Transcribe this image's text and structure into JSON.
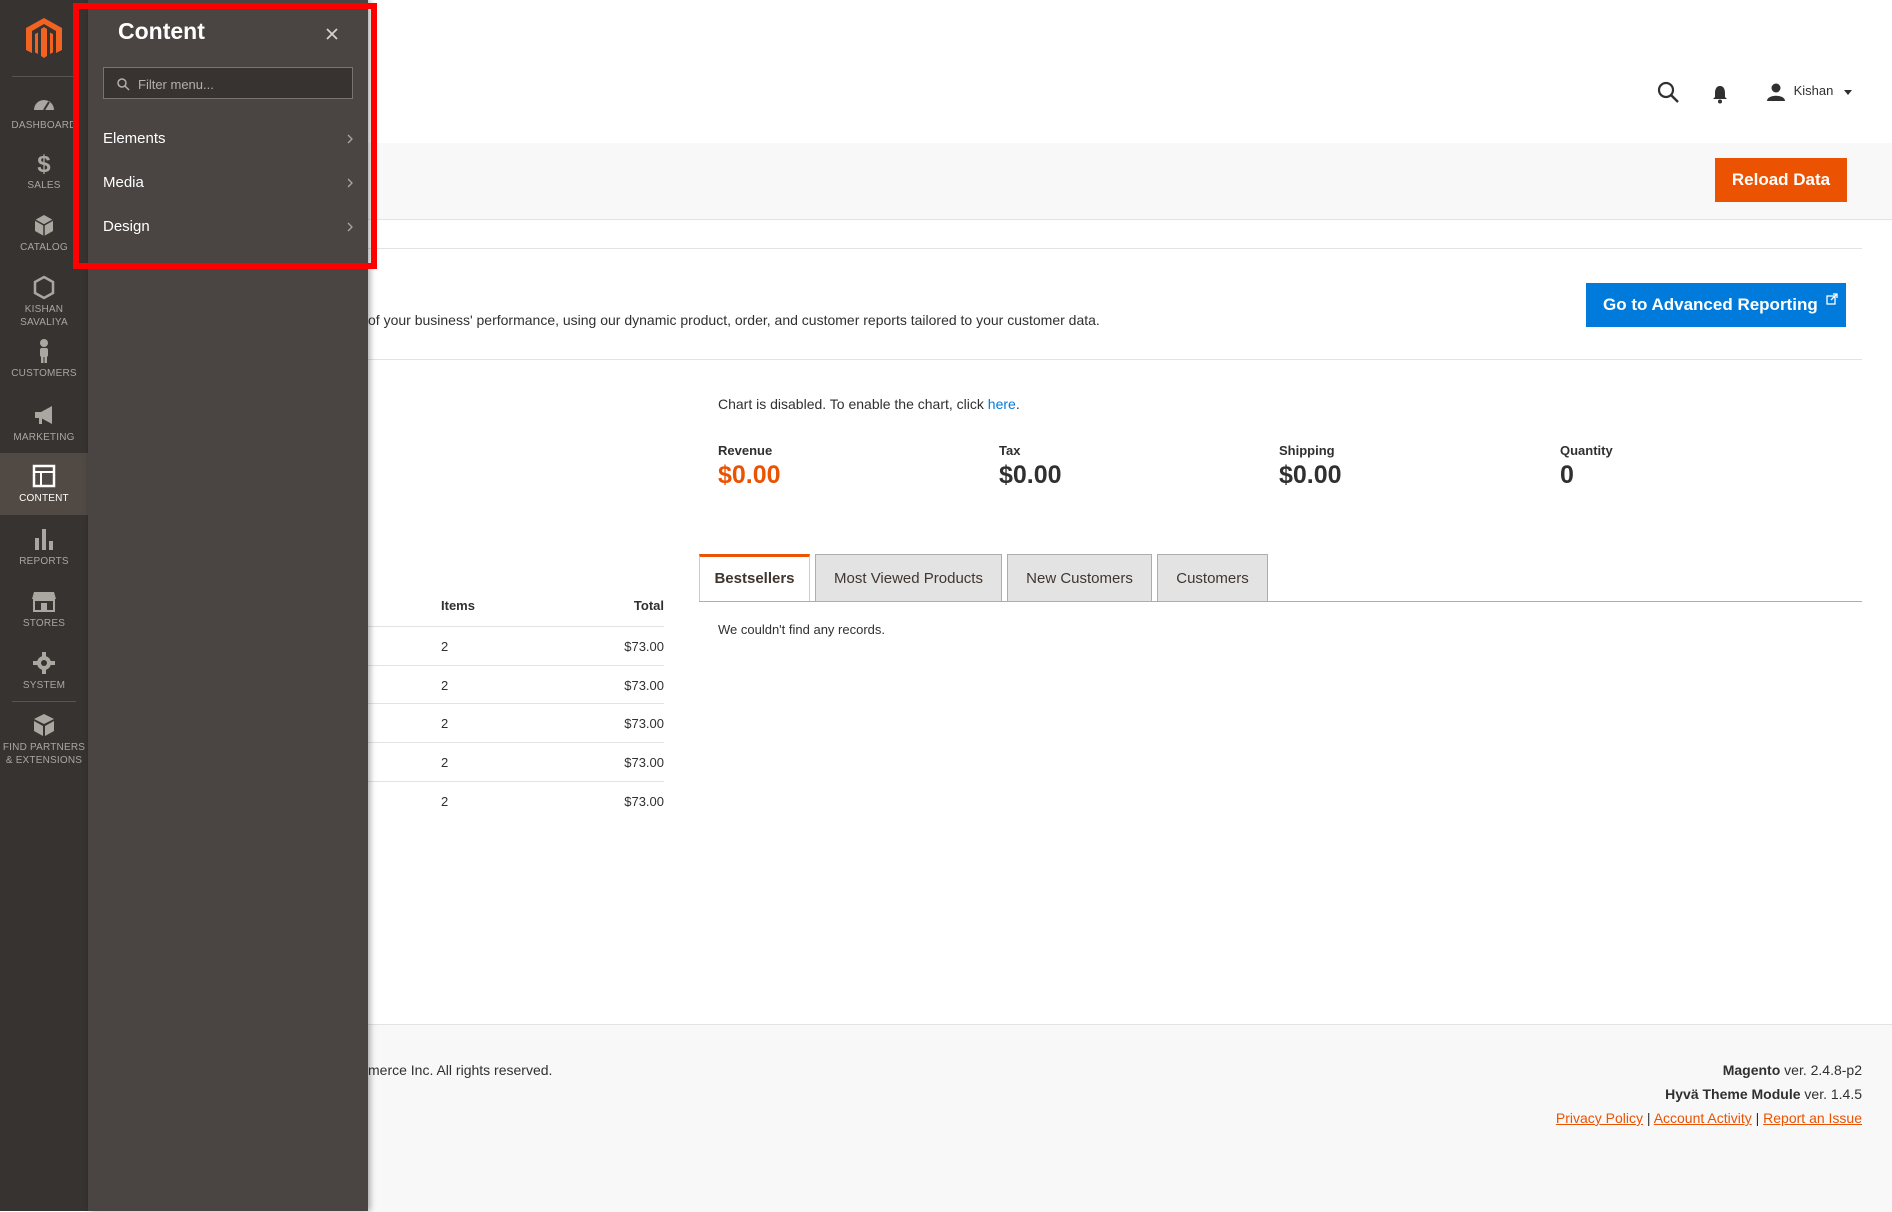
{
  "nav": {
    "items": [
      {
        "label": "DASHBOARD",
        "icon": "dashboard-icon"
      },
      {
        "label": "SALES",
        "icon": "dollar-icon"
      },
      {
        "label": "CATALOG",
        "icon": "box-icon"
      },
      {
        "label": "KISHAN SAVALIYA",
        "line1": "KISHAN",
        "line2": "SAVALIYA",
        "icon": "hexagon-icon"
      },
      {
        "label": "CUSTOMERS",
        "icon": "person-icon"
      },
      {
        "label": "MARKETING",
        "icon": "megaphone-icon"
      },
      {
        "label": "CONTENT",
        "icon": "layout-icon"
      },
      {
        "label": "REPORTS",
        "icon": "bar-chart-icon"
      },
      {
        "label": "STORES",
        "icon": "storefront-icon"
      },
      {
        "label": "SYSTEM",
        "icon": "gear-icon"
      },
      {
        "label": "FIND PARTNERS & EXTENSIONS",
        "line1": "FIND PARTNERS",
        "line2": "& EXTENSIONS",
        "icon": "cubes-icon"
      }
    ],
    "active": "CONTENT"
  },
  "flyout": {
    "title": "Content",
    "filter_placeholder": "Filter menu...",
    "items": [
      "Elements",
      "Media",
      "Design"
    ]
  },
  "header": {
    "user_name": "Kishan"
  },
  "actions": {
    "reload_label": "Reload Data",
    "advanced_reporting_label": "Go to Advanced Reporting",
    "advanced_reporting_text": "of your business' performance, using our dynamic product, order, and customer reports tailored to your customer data."
  },
  "chart": {
    "disabled_text": "Chart is disabled. To enable the chart, click ",
    "link_text": "here",
    "suffix": "."
  },
  "metrics": [
    {
      "label": "Revenue",
      "value": "$0.00"
    },
    {
      "label": "Tax",
      "value": "$0.00"
    },
    {
      "label": "Shipping",
      "value": "$0.00"
    },
    {
      "label": "Quantity",
      "value": "0"
    }
  ],
  "orders_table": {
    "columns": [
      "Items",
      "Total"
    ],
    "rows": [
      {
        "items": "2",
        "total": "$73.00"
      },
      {
        "items": "2",
        "total": "$73.00"
      },
      {
        "items": "2",
        "total": "$73.00"
      },
      {
        "items": "2",
        "total": "$73.00"
      },
      {
        "items": "2",
        "total": "$73.00"
      }
    ]
  },
  "tabs": {
    "labels": [
      "Bestsellers",
      "Most Viewed Products",
      "New Customers",
      "Customers"
    ],
    "active": "Bestsellers",
    "empty_text": "We couldn't find any records."
  },
  "footer": {
    "copyright": "merce Inc. All rights reserved.",
    "magento_name": "Magento",
    "magento_ver": " ver. 2.4.8-p2",
    "hyva_name": "Hyvä Theme Module",
    "hyva_ver": " ver. 1.4.5",
    "links": [
      "Privacy Policy",
      "Account Activity",
      "Report an Issue"
    ]
  },
  "colors": {
    "accent": "#eb5202",
    "link_blue": "#007bdb",
    "nav_bg": "#373330",
    "flyout_bg": "#4a4542",
    "highlight": "#ff0000"
  }
}
